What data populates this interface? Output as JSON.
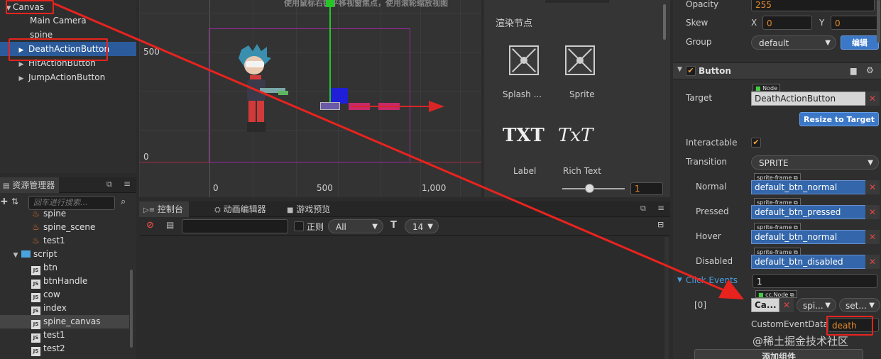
{
  "hierarchy": {
    "items": [
      {
        "label": "Canvas",
        "arrow": "▼"
      },
      {
        "label": "Main Camera"
      },
      {
        "label": "spine"
      },
      {
        "label": "DeathActionButton",
        "arrow": "▶"
      },
      {
        "label": "HitActionButton",
        "arrow": "▶"
      },
      {
        "label": "JumpActionButton",
        "arrow": "▶"
      }
    ]
  },
  "scene": {
    "hint": "使用鼠标右键平移视窗焦点，使用滚轮缩放视图",
    "y_labels": [
      "500",
      "0"
    ],
    "x_labels": [
      "0",
      "500",
      "1,000"
    ]
  },
  "node_library": {
    "title": "渲染节点",
    "items": [
      "Splash ...",
      "Sprite",
      "Label",
      "Rich Text"
    ],
    "txt_glyph": "TXT",
    "rich_glyph": "TxT",
    "zoom_value": "1"
  },
  "assets": {
    "title": "资源管理器",
    "search_placeholder": "回车进行搜索...",
    "items": [
      {
        "label": "spine",
        "kind": "fire",
        "indent": 44
      },
      {
        "label": "spine_scene",
        "kind": "fire",
        "indent": 44
      },
      {
        "label": "test1",
        "kind": "fire",
        "indent": 44
      },
      {
        "label": "script",
        "kind": "folder",
        "indent": 18
      },
      {
        "label": "btn",
        "kind": "js",
        "indent": 44
      },
      {
        "label": "btnHandle",
        "kind": "js",
        "indent": 44
      },
      {
        "label": "cow",
        "kind": "js",
        "indent": 44
      },
      {
        "label": "index",
        "kind": "js",
        "indent": 44
      },
      {
        "label": "spine_canvas",
        "kind": "js",
        "indent": 44,
        "selected": true
      },
      {
        "label": "test1",
        "kind": "js",
        "indent": 44
      },
      {
        "label": "test2",
        "kind": "js",
        "indent": 44
      }
    ],
    "js_badge": "JS"
  },
  "console": {
    "tabs": [
      "控制台",
      "动画编辑器",
      "游戏预览"
    ],
    "regex_label": "正则",
    "filter_level": "All",
    "font_size": "14"
  },
  "inspector": {
    "opacity_label": "Opacity",
    "opacity_value": "255",
    "skew_label": "Skew",
    "skew_x_label": "X",
    "skew_x": "0",
    "skew_y_label": "Y",
    "skew_y": "0",
    "group_label": "Group",
    "group_value": "default",
    "edit_button": "编辑",
    "component_title": "Button",
    "target_label": "Target",
    "node_tag": "Node",
    "target_value": "DeathActionButton",
    "resize_button": "Resize to Target",
    "interactable_label": "Interactable",
    "transition_label": "Transition",
    "transition_value": "SPRITE",
    "sprite_frame_tag": "sprite-frame",
    "states": [
      {
        "label": "Normal",
        "value": "default_btn_normal"
      },
      {
        "label": "Pressed",
        "value": "default_btn_pressed"
      },
      {
        "label": "Hover",
        "value": "default_btn_normal"
      },
      {
        "label": "Disabled",
        "value": "default_btn_disabled"
      }
    ],
    "click_events_label": "Click Events",
    "click_events_count": "1",
    "event_index": "[0]",
    "cc_node_tag": "cc.Node",
    "event_target": "Ca...",
    "event_component": "spi...",
    "event_handler": "set...",
    "custom_event_label": "CustomEventData",
    "custom_event_value": "death",
    "add_component_button": "添加组件"
  },
  "watermark": "@稀土掘金技术社区",
  "colors": {
    "selection": "#2b5b9a",
    "annotation_red": "#e8231e",
    "accent_orange": "#e48a2c",
    "object_blue": "#3366aa"
  }
}
